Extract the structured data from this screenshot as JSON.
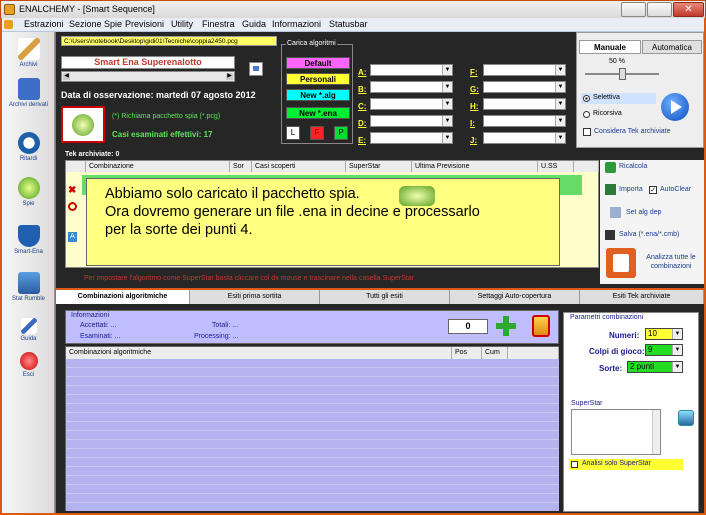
{
  "window": {
    "title": "ENALCHEMY - [Smart Sequence]"
  },
  "menu": [
    "Estrazioni",
    "Sezione Spie",
    "Previsioni",
    "Utility",
    "Finestra",
    "Guida",
    "Informazioni",
    "Statusbar"
  ],
  "sidebar": [
    "Archivi",
    "Archivi derivati",
    "Ritardi",
    "Spie",
    "Smart-Ena",
    "Stat Rumble",
    "Guida",
    "Esci"
  ],
  "path": "C:\\Users\\notebook\\Desktop\\gidi01\\Tecniche\\coppia2450.pcg",
  "game": "Smart Ena Superenalotto",
  "obs_date": "Data di osservazione:  martedì 07 agosto 2012",
  "richiama": "(*) Richiama pacchetto spia (*.pcg)",
  "casi": "Casi esaminati effettivi: 17",
  "carica": {
    "label": "Carica algoritmi",
    "buttons": [
      "Default",
      "Personali",
      "New *.alg",
      "New *.ena"
    ],
    "small": [
      "L",
      "F",
      "P"
    ]
  },
  "slots_left": [
    "A:",
    "B:",
    "C:",
    "D:",
    "E:"
  ],
  "slots_right": [
    "F:",
    "G:",
    "H:",
    "I:",
    "J:"
  ],
  "right_panel": {
    "tab_manual": "Manuale",
    "tab_auto": "Automatica",
    "percent": "50 %",
    "sel1": "Selettiva",
    "sel2": "Ricorsiva",
    "check": "Considera Tek archiviate"
  },
  "tek": {
    "title": "Tek archiviate: 0",
    "headers": [
      "Combinazione",
      "Sor",
      "Casi scoperti",
      "SuperStar",
      "Ultima Previsione",
      "U.SS"
    ]
  },
  "banner": {
    "line1": "Abbiamo solo caricato il pacchetto spia.",
    "line2": "Ora dovremo generare un file .ena in decine e processarlo",
    "line3": "per la sorte dei punti 4."
  },
  "tek_buttons": {
    "ricalcola": "Ricalcola",
    "importa": "Importa",
    "autoclear": "AutoClear",
    "setalg": "Set alg dep",
    "salva": "Salva (*.ena/*.cmb)",
    "analizza": "Analizza tutte le combinazioni"
  },
  "hint": "Per impostare l'algoritmo come SuperStar basta cliccare col dx mouse e trascinare nella casella SuperStar",
  "tabs": [
    "Combinazioni algoritmiche",
    "Esiti prima sortita",
    "Tutti gli esiti",
    "Settaggi Auto-copertura",
    "Esiti Tek archiviate"
  ],
  "info": {
    "title": "Informazioni",
    "accettati": "Accettati:  ...",
    "esaminati": "Esaminati:  ...",
    "totali": "Totali:  ...",
    "processing": "Processing:  ...",
    "count": "0"
  },
  "grid_headers": [
    "Combinazioni algoritmiche",
    "Pos",
    "Cum"
  ],
  "params": {
    "title": "Parametri combinazioni",
    "numeri_lbl": "Numeri:",
    "numeri": "10",
    "colpi_lbl": "Colpi di gioco:",
    "colpi": "9",
    "sorte_lbl": "Sorte:",
    "sorte": "2 punti",
    "superstar": "SuperStar",
    "analisi": "Analisi solo SuperStar"
  }
}
